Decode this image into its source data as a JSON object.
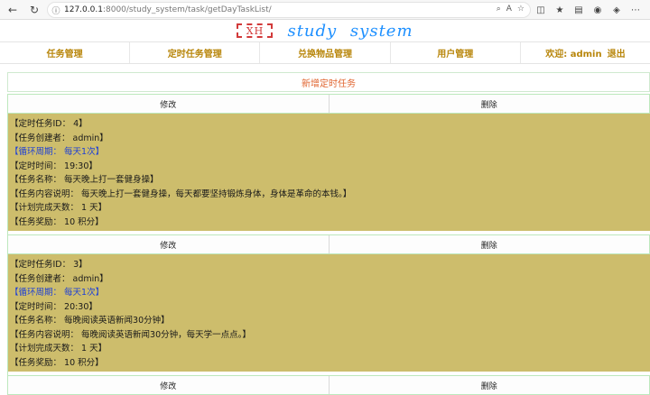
{
  "browser": {
    "url_host": "127.0.0.1",
    "url_path": ":8000/study_system/task/getDayTaskList/"
  },
  "logo": {
    "text": "XH"
  },
  "site_title": "study system",
  "menu": {
    "items": [
      {
        "label": "任务管理"
      },
      {
        "label": "定时任务管理"
      },
      {
        "label": "兑换物品管理"
      },
      {
        "label": "用户管理"
      }
    ],
    "welcome": "欢迎: admin",
    "logout": "退出"
  },
  "add_task": "新增定时任务",
  "actions": {
    "edit": "修改",
    "delete": "删除"
  },
  "tasks": [
    {
      "id": "【定时任务ID： 4】",
      "creator": "【任务创建者： admin】",
      "cycle": "【循环周期： 每天1次】",
      "time": "【定时时间： 19:30】",
      "name": "【任务名称： 每天晚上打一套健身操】",
      "desc": "【任务内容说明： 每天晚上打一套健身操，每天都要坚持锻炼身体，身体是革命的本钱。】",
      "days": "【计划完成天数： 1 天】",
      "reward": "【任务奖励： 10 积分】"
    },
    {
      "id": "【定时任务ID： 3】",
      "creator": "【任务创建者： admin】",
      "cycle": "【循环周期： 每天1次】",
      "time": "【定时时间： 20:30】",
      "name": "【任务名称： 每晚阅读英语新闻30分钟】",
      "desc": "【任务内容说明： 每晚阅读英语新闻30分钟，每天学一点点。】",
      "days": "【计划完成天数： 1 天】",
      "reward": "【任务奖励： 10 积分】"
    }
  ]
}
